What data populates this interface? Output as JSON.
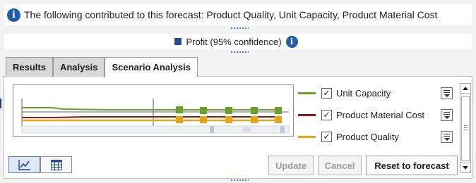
{
  "info": {
    "icon": "info-icon",
    "text": "The following contributed to this forecast: Product Quality, Unit Capacity, Product Material Cost"
  },
  "legend": {
    "label": "Profit (95% confidence)",
    "swatch_color": "#2a4b8d",
    "icon": "info-icon"
  },
  "tabs": [
    {
      "label": "Results",
      "active": false
    },
    {
      "label": "Analysis",
      "active": false
    },
    {
      "label": "Scenario Analysis",
      "active": true
    }
  ],
  "series": [
    {
      "label": "Unit Capacity",
      "color": "#6aa12a",
      "checked": true
    },
    {
      "label": "Product Material Cost",
      "color": "#8b1a1a",
      "checked": true
    },
    {
      "label": "Product Quality",
      "color": "#e8a317",
      "checked": true
    }
  ],
  "checkmark": "✓",
  "view_toggle": [
    {
      "icon": "line-chart-icon",
      "active": true
    },
    {
      "icon": "table-icon",
      "active": false
    }
  ],
  "buttons": {
    "update": "Update",
    "cancel": "Cancel",
    "reset": "Reset to forecast"
  },
  "colors": {
    "accent": "#1f5ea8",
    "unit_capacity": "#6aa12a",
    "material_cost": "#8b1a1a",
    "product_quality": "#e8a317"
  }
}
